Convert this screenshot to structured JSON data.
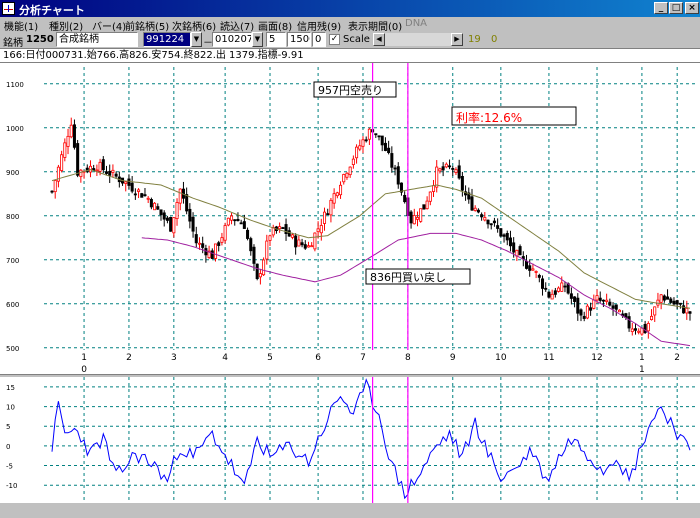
{
  "window": {
    "title": "分析チャート",
    "controls": [
      "_",
      "□",
      "×"
    ]
  },
  "menu": {
    "items": [
      "機能(1)",
      "種別(2)",
      "バー(4)",
      "前銘柄(5)",
      "次銘柄(6)",
      "読込(7)",
      "画面(8)",
      "信用残(9)",
      "表示期間(0)",
      "DNA"
    ]
  },
  "toolbar": {
    "stock_label": "銘柄",
    "stock_code": "1250",
    "stock_name": "合成銘柄",
    "start_date": "991224",
    "separator": "－",
    "end_date": "010207",
    "param1": "5",
    "param2": "1500",
    "param3": "0",
    "scale_checked": "✓",
    "scale_label": "Scale",
    "value_a": "19",
    "value_b": "0"
  },
  "info_line": "166:日付000731.始766.高826.安754.終822.出 1379.指標-9.91",
  "colors": {
    "up": "#ff0000",
    "down": "#000000",
    "ma_short": "#808040",
    "ma_long": "#a020a0",
    "oscillator": "#0000ff",
    "marker": "#ff00ff",
    "grid": "#008080"
  },
  "chart_data": [
    {
      "type": "candlestick",
      "y_ticks": [
        500,
        600,
        700,
        800,
        900,
        1000,
        1100
      ],
      "ylim": [
        495,
        1120
      ],
      "x_month_labels": [
        "1",
        "2",
        "3",
        "4",
        "5",
        "6",
        "7",
        "8",
        "9",
        "10",
        "11",
        "12",
        "1",
        "2"
      ],
      "x_month_index": [
        10,
        24,
        38,
        54,
        68,
        83,
        97,
        111,
        125,
        140,
        155,
        170,
        184,
        195
      ],
      "x_year_labels": [
        {
          "label": "0",
          "index": 10
        },
        {
          "label": "1",
          "index": 184
        }
      ],
      "bars_count": 200,
      "vertical_markers": [
        100,
        111
      ],
      "annotations": [
        {
          "text": "957円空売り",
          "color": "#000000",
          "boxed": true
        },
        {
          "text": "利率:12.6%",
          "color": "#ff0000",
          "boxed": true
        },
        {
          "text": "836円買い戻し",
          "color": "#000000",
          "boxed": true
        }
      ],
      "close_anchors": [
        [
          0,
          855
        ],
        [
          6,
          1015
        ],
        [
          8,
          900
        ],
        [
          14,
          915
        ],
        [
          22,
          880
        ],
        [
          30,
          840
        ],
        [
          37,
          775
        ],
        [
          40,
          860
        ],
        [
          45,
          740
        ],
        [
          50,
          710
        ],
        [
          56,
          800
        ],
        [
          60,
          780
        ],
        [
          64,
          650
        ],
        [
          68,
          760
        ],
        [
          72,
          770
        ],
        [
          76,
          740
        ],
        [
          80,
          730
        ],
        [
          85,
          800
        ],
        [
          90,
          880
        ],
        [
          96,
          960
        ],
        [
          100,
          1000
        ],
        [
          104,
          950
        ],
        [
          108,
          880
        ],
        [
          112,
          790
        ],
        [
          116,
          820
        ],
        [
          120,
          900
        ],
        [
          125,
          910
        ],
        [
          130,
          830
        ],
        [
          135,
          800
        ],
        [
          140,
          760
        ],
        [
          146,
          700
        ],
        [
          150,
          680
        ],
        [
          155,
          620
        ],
        [
          160,
          640
        ],
        [
          165,
          570
        ],
        [
          170,
          610
        ],
        [
          175,
          590
        ],
        [
          180,
          550
        ],
        [
          185,
          540
        ],
        [
          190,
          620
        ],
        [
          194,
          600
        ],
        [
          199,
          580
        ]
      ],
      "ma_short_anchors": [
        [
          0,
          880
        ],
        [
          12,
          905
        ],
        [
          22,
          880
        ],
        [
          34,
          870
        ],
        [
          44,
          840
        ],
        [
          52,
          820
        ],
        [
          62,
          790
        ],
        [
          70,
          770
        ],
        [
          80,
          750
        ],
        [
          86,
          755
        ],
        [
          96,
          800
        ],
        [
          104,
          850
        ],
        [
          112,
          860
        ],
        [
          120,
          870
        ],
        [
          126,
          860
        ],
        [
          134,
          840
        ],
        [
          142,
          800
        ],
        [
          150,
          760
        ],
        [
          158,
          720
        ],
        [
          166,
          670
        ],
        [
          174,
          640
        ],
        [
          182,
          610
        ],
        [
          190,
          600
        ],
        [
          199,
          590
        ]
      ],
      "ma_long_anchors": [
        [
          28,
          750
        ],
        [
          36,
          745
        ],
        [
          44,
          730
        ],
        [
          54,
          705
        ],
        [
          64,
          680
        ],
        [
          72,
          665
        ],
        [
          82,
          650
        ],
        [
          90,
          665
        ],
        [
          98,
          700
        ],
        [
          108,
          745
        ],
        [
          118,
          760
        ],
        [
          126,
          760
        ],
        [
          134,
          745
        ],
        [
          142,
          720
        ],
        [
          150,
          690
        ],
        [
          158,
          660
        ],
        [
          166,
          620
        ],
        [
          174,
          590
        ],
        [
          182,
          555
        ],
        [
          190,
          515
        ],
        [
          199,
          505
        ]
      ]
    },
    {
      "type": "line",
      "y_ticks": [
        -10,
        -5,
        0,
        5,
        10,
        15
      ],
      "ylim": [
        -13,
        16
      ],
      "series_anchors": [
        [
          0,
          0
        ],
        [
          2,
          10
        ],
        [
          4,
          3
        ],
        [
          8,
          4
        ],
        [
          12,
          -2
        ],
        [
          16,
          2
        ],
        [
          20,
          -8
        ],
        [
          26,
          -2
        ],
        [
          32,
          -5
        ],
        [
          36,
          -9
        ],
        [
          40,
          0
        ],
        [
          44,
          -3
        ],
        [
          50,
          3
        ],
        [
          56,
          -5
        ],
        [
          60,
          -11
        ],
        [
          64,
          2
        ],
        [
          68,
          -3
        ],
        [
          74,
          0
        ],
        [
          80,
          -4
        ],
        [
          86,
          7
        ],
        [
          90,
          13
        ],
        [
          94,
          8
        ],
        [
          98,
          15
        ],
        [
          102,
          8
        ],
        [
          106,
          -5
        ],
        [
          110,
          -12
        ],
        [
          114,
          -8
        ],
        [
          120,
          0
        ],
        [
          124,
          3
        ],
        [
          128,
          -3
        ],
        [
          132,
          6
        ],
        [
          136,
          -2
        ],
        [
          140,
          -8
        ],
        [
          144,
          -6
        ],
        [
          150,
          -1
        ],
        [
          154,
          -9
        ],
        [
          158,
          -3
        ],
        [
          162,
          2
        ],
        [
          166,
          -1
        ],
        [
          172,
          -6
        ],
        [
          176,
          -2
        ],
        [
          180,
          -9
        ],
        [
          186,
          5
        ],
        [
          190,
          10
        ],
        [
          194,
          5
        ],
        [
          199,
          -2
        ]
      ]
    }
  ]
}
